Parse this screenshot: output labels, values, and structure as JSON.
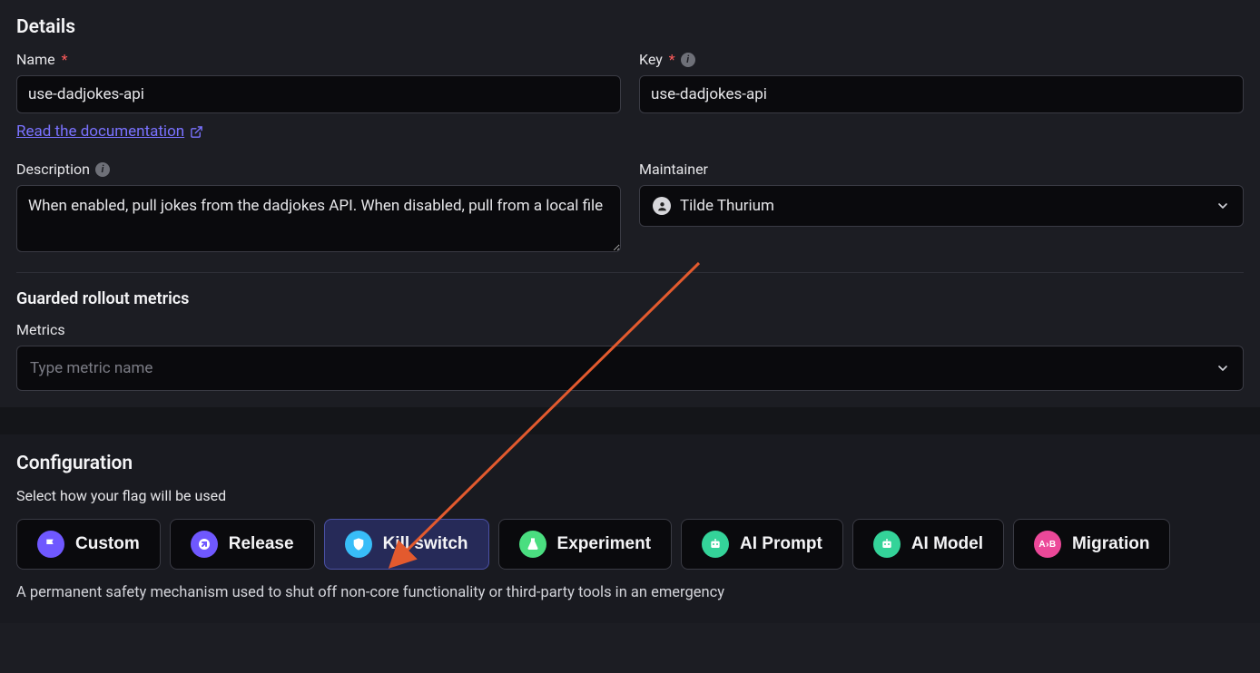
{
  "details": {
    "heading": "Details",
    "name_label": "Name",
    "name_value": "use-dadjokes-api",
    "doc_link": "Read the documentation",
    "key_label": "Key",
    "key_value": "use-dadjokes-api",
    "description_label": "Description",
    "description_value": "When enabled, pull jokes from the dadjokes API. When disabled, pull from a local file",
    "maintainer_label": "Maintainer",
    "maintainer_value": "Tilde Thurium"
  },
  "guarded": {
    "heading": "Guarded rollout metrics",
    "metrics_label": "Metrics",
    "metrics_placeholder": "Type metric name"
  },
  "config": {
    "heading": "Configuration",
    "helper": "Select how your flag will be used",
    "types": {
      "custom": "Custom",
      "release": "Release",
      "kill_switch": "Kill switch",
      "experiment": "Experiment",
      "ai_prompt": "AI Prompt",
      "ai_model": "AI Model",
      "migration": "Migration"
    },
    "selected_desc": "A permanent safety mechanism used to shut off non-core functionality or third-party tools in an emergency"
  }
}
